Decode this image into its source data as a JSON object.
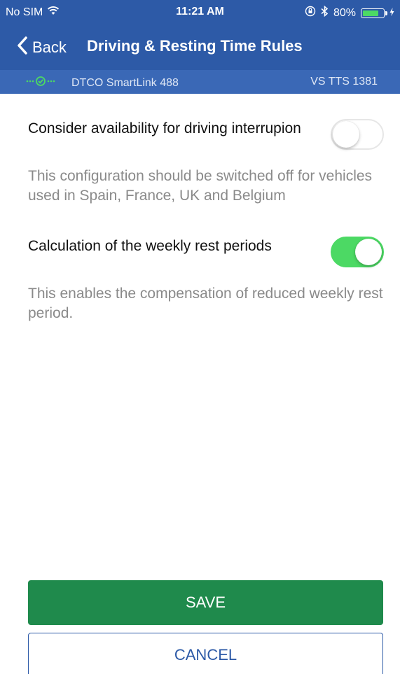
{
  "status_bar": {
    "carrier": "No SIM",
    "time": "11:21 AM",
    "battery_percent": "80%",
    "battery_level": 0.8,
    "icons": [
      "wifi-icon",
      "rotation-lock-icon",
      "bluetooth-icon",
      "battery-icon",
      "charging-icon"
    ]
  },
  "nav": {
    "back_label": "Back",
    "title": "Driving & Resting Time Rules"
  },
  "device": {
    "name": "DTCO SmartLink 488",
    "vehicle": "VS TTS 1381",
    "connection_icon": "connected-icon"
  },
  "settings": [
    {
      "label": "Consider availability for driving interrupion",
      "enabled": false,
      "description": "This configuration should be switched off for vehicles used in Spain, France, UK and Belgium"
    },
    {
      "label": "Calculation of the weekly rest periods",
      "enabled": true,
      "description": "This enables the compensation of reduced weekly rest period."
    }
  ],
  "buttons": {
    "save": "SAVE",
    "cancel": "CANCEL"
  },
  "colors": {
    "header": "#2d5aa7",
    "device_bar": "#3a68b6",
    "toggle_on": "#4cd964",
    "save_button": "#1f8a4c",
    "cancel_text": "#2d5aa7"
  }
}
